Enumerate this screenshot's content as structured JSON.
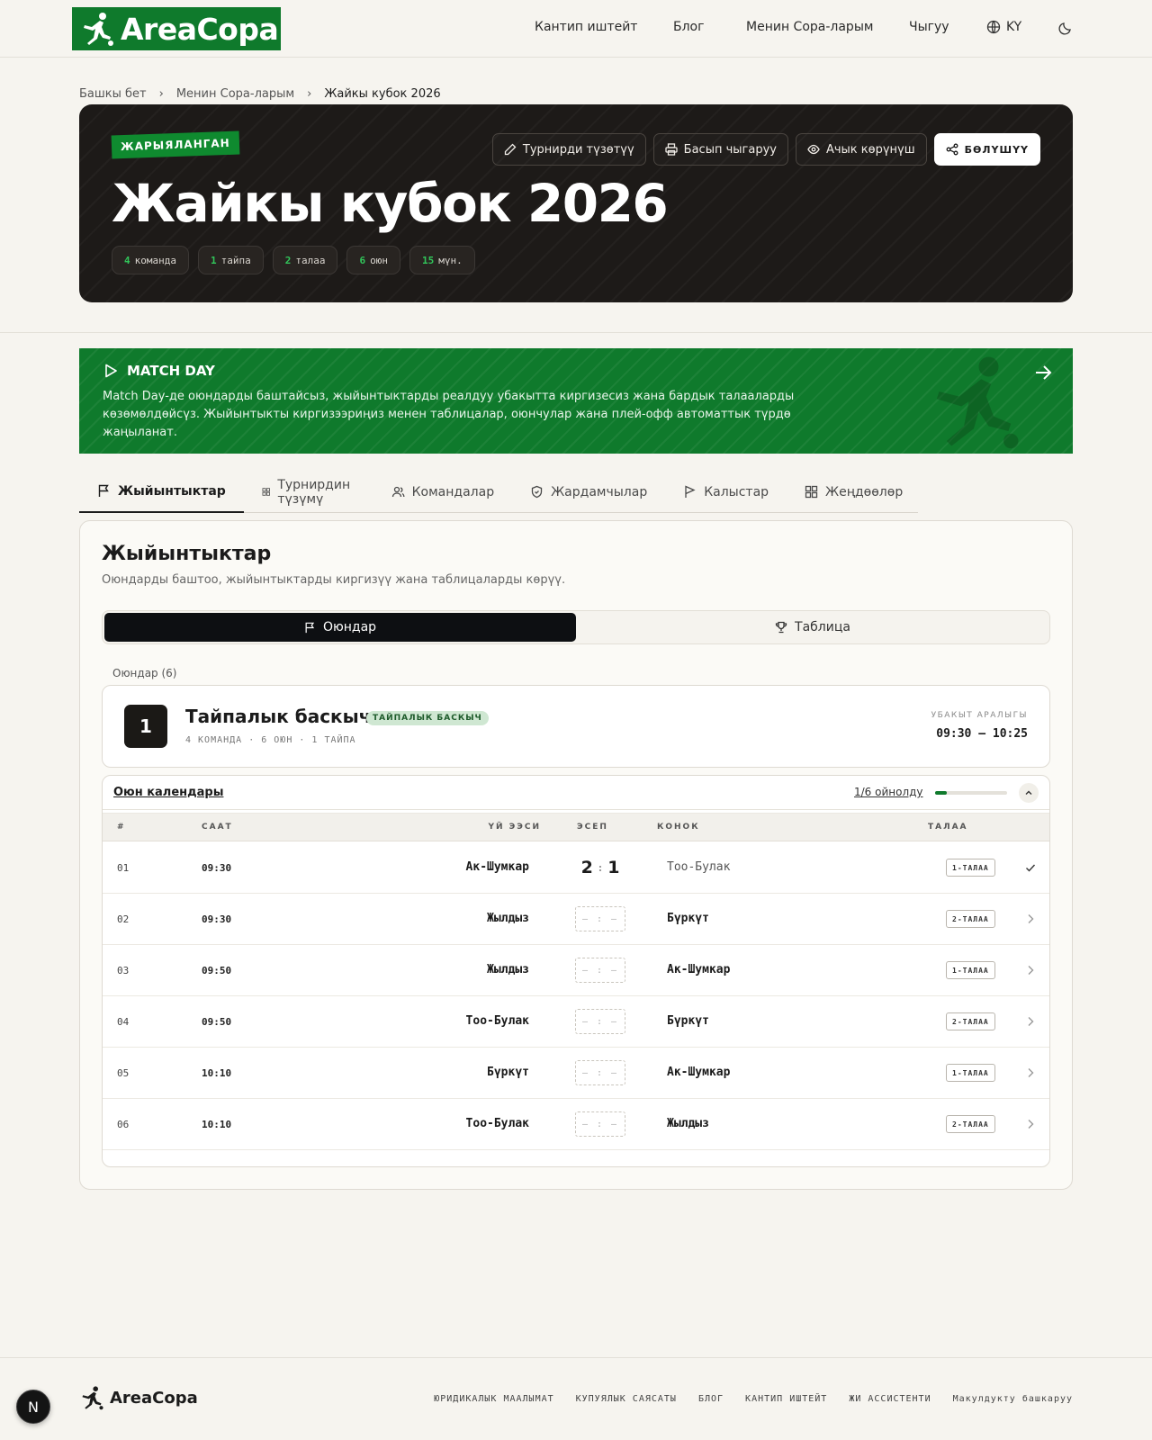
{
  "header": {
    "logo_text": "AreaCopa",
    "nav": [
      "Кантип иштейт",
      "Блог",
      "Менин Сора-ларым",
      "Чыгуу"
    ],
    "lang": "KY"
  },
  "breadcrumb": [
    "Башкы бет",
    "Менин Сора-ларым",
    "Жайкы кубок 2026"
  ],
  "hero": {
    "status_badge": "ЖАРЫЯЛАНГАН",
    "title": "Жайкы кубок 2026",
    "stats": [
      {
        "value": "4",
        "label": "команда"
      },
      {
        "value": "1",
        "label": "тайпа"
      },
      {
        "value": "2",
        "label": "талаа"
      },
      {
        "value": "6",
        "label": "оюн"
      },
      {
        "value": "15",
        "label": "мүн."
      }
    ],
    "actions": {
      "edit": "Турнирди түзөтүү",
      "print": "Басып чыгаруу",
      "public": "Ачык көрүнүш",
      "share": "БӨЛҮШҮҮ"
    }
  },
  "matchday": {
    "title": "MATCH DAY",
    "text": "Match Day-де оюндарды баштайсыз, жыйынтыктарды реалдуу убакытта киргизесиз жана бардык талааларды көзөмөлдөйсүз. Жыйынтыкты киргизээриңиз менен таблицалар, оюнчулар жана плей-офф автоматтык түрдө жаңыланат."
  },
  "tabs": [
    "Жыйынтыктар",
    "Турнирдин түзүмү",
    "Командалар",
    "Жардамчылар",
    "Калыстар",
    "Жеңдөөлөр"
  ],
  "results": {
    "title": "Жыйынтыктар",
    "subtitle": "Оюндарды баштоо, жыйынтыктарды киргизүү жана таблицаларды көрүү.",
    "seg_games": "Оюндар",
    "seg_table": "Таблица",
    "games_label": "Оюндар (6)",
    "stage": {
      "number": "1",
      "name": "Тайпалык баскыч",
      "badge": "ТАЙПАЛЫК БАСКЫЧ",
      "meta": "4 КОМАНДА · 6 ОЮН · 1 ТАЙПА",
      "time_label": "УБАКЫТ АРАЛЫГЫ",
      "time_value": "09:30 – 10:25"
    },
    "schedule": {
      "title": "Оюн календары",
      "progress_text": "1/6 ойнолду",
      "progress": 0.1667,
      "headers": {
        "num": "#",
        "time": "СААТ",
        "home": "ҮЙ ЭЭСИ",
        "score": "ЭСЕП",
        "away": "КОНОК",
        "field": "ТАЛАА"
      },
      "rows": [
        {
          "num": "01",
          "time": "09:30",
          "home": "Ак-Шумкар",
          "score_home": "2",
          "score_away": "1",
          "away": "Тоо-Булак",
          "field": "1-ТАЛАА",
          "played": true
        },
        {
          "num": "02",
          "time": "09:30",
          "home": "Жылдыз",
          "empty_score": "– : –",
          "away": "Бүркүт",
          "field": "2-ТАЛАА",
          "played": false
        },
        {
          "num": "03",
          "time": "09:50",
          "home": "Жылдыз",
          "empty_score": "– : –",
          "away": "Ак-Шумкар",
          "field": "1-ТАЛАА",
          "played": false
        },
        {
          "num": "04",
          "time": "09:50",
          "home": "Тоо-Булак",
          "empty_score": "– : –",
          "away": "Бүркүт",
          "field": "2-ТАЛАА",
          "played": false
        },
        {
          "num": "05",
          "time": "10:10",
          "home": "Бүркүт",
          "empty_score": "– : –",
          "away": "Ак-Шумкар",
          "field": "1-ТАЛАА",
          "played": false
        },
        {
          "num": "06",
          "time": "10:10",
          "home": "Тоо-Булак",
          "empty_score": "– : –",
          "away": "Жылдыз",
          "field": "2-ТАЛАА",
          "played": false
        }
      ]
    }
  },
  "footer": {
    "logo_text": "AreaCopa",
    "links": [
      "ЮРИДИКАЛЫК МААЛЫМАТ",
      "КУПУЯЛЫК САЯСАТЫ",
      "БЛОГ",
      "КАНТИП ИШТЕЙТ",
      "ЖИ АССИСТЕНТИ",
      "Макулдукту башкаруу"
    ]
  },
  "dev_badge": "N",
  "colors": {
    "brand": "#0f7a2c",
    "hero_bg": "#1d1a18",
    "accent_stat": "#31c55a"
  }
}
